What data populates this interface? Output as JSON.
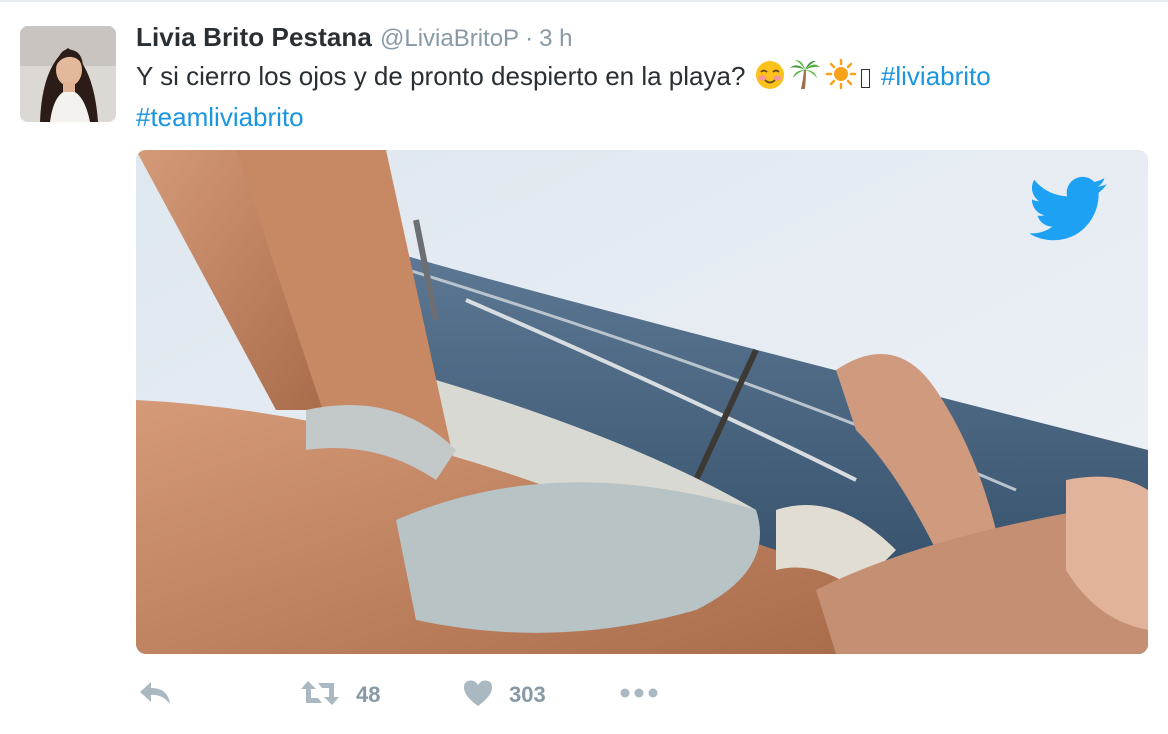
{
  "tweet": {
    "author_name": "Livia Brito Pestana",
    "author_handle": "@LiviaBritoP",
    "separator": "·",
    "time": "3 h",
    "text_main": "Y si cierro los ojos y de pronto despierto en la playa?",
    "hashtags": [
      "#liviabrito",
      "#teamliviabrito"
    ],
    "emojis": [
      "smiling-face-with-blush-icon",
      "palm-tree-icon",
      "sun-icon",
      "missing-glyph"
    ]
  },
  "media": {
    "description_icon": "twitter-bird-icon"
  },
  "actions": {
    "reply_icon": "reply-icon",
    "retweet_icon": "retweet-icon",
    "retweet_count": "48",
    "like_icon": "heart-icon",
    "like_count": "303",
    "more_icon": "more-dots-icon"
  },
  "colors": {
    "link": "#1b95e0",
    "muted": "#8899a6",
    "text": "#292f33",
    "twitter_blue": "#1da1f2"
  }
}
